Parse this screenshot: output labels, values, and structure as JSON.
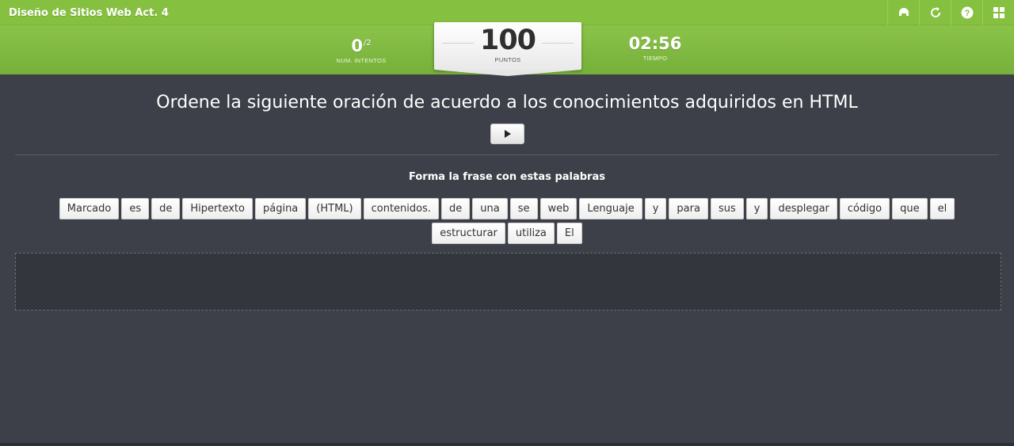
{
  "header": {
    "title": "Diseño de Sitios Web Act. 4",
    "tools": [
      {
        "name": "home-icon"
      },
      {
        "name": "restart-icon"
      },
      {
        "name": "help-icon"
      },
      {
        "name": "grid-icon"
      }
    ]
  },
  "scoreboard": {
    "attempts_value": "0",
    "attempts_total": "/2",
    "attempts_label": "NUM. INTENTOS",
    "points_value": "100",
    "points_label": "PUNTOS",
    "time_value": "02:56",
    "time_label": "TIEMPO"
  },
  "activity": {
    "instruction": "Ordene la siguiente oración de acuerdo a los conocimientos adquiridos en HTML",
    "subtitle": "Forma la frase con estas palabras",
    "words": [
      "Marcado",
      "es",
      "de",
      "Hipertexto",
      "página",
      "(HTML)",
      "contenidos.",
      "de",
      "una",
      "se",
      "web",
      "Lenguaje",
      "y",
      "para",
      "sus",
      "y",
      "desplegar",
      "código",
      "que",
      "el",
      "estructurar",
      "utiliza",
      "El"
    ]
  },
  "colors": {
    "accent": "#86c040",
    "background": "#3d4048"
  }
}
